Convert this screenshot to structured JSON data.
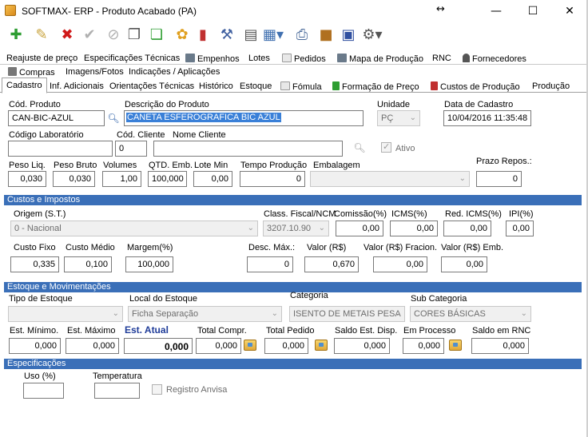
{
  "window": {
    "title": "SOFTMAX- ERP - Produto Acabado (PA)"
  },
  "tabs_row1": [
    "Reajuste de preço",
    "Especificações Técnicas",
    "Empenhos",
    "Lotes",
    "Pedidos",
    "Mapa de Produção",
    "RNC",
    "Fornecedores"
  ],
  "tabs_row2": [
    "Compras",
    "Imagens/Fotos",
    "Indicações / Aplicações"
  ],
  "tabs_row3": [
    "Cadastro",
    "Inf. Adicionais",
    "Orientações Técnicas",
    "Histórico",
    "Estoque",
    "Fómula",
    "Formação de Preço",
    "Custos de Produção",
    "Produção"
  ],
  "cadastro": {
    "cod_produto_label": "Cód. Produto",
    "cod_produto": "CAN-BIC-AZUL",
    "descricao_label": "Descrição do Produto",
    "descricao": "CANETA ESFEROGRAFICA BIC AZUL",
    "unidade_label": "Unidade",
    "unidade": "PÇ",
    "data_cadastro_label": "Data de Cadastro",
    "data_cadastro": "10/04/2016 11:35:48",
    "codigo_lab_label": "Código Laboratório",
    "codigo_lab": "",
    "cod_cliente_label": "Cód. Cliente",
    "cod_cliente": "0",
    "nome_cliente_label": "Nome Cliente",
    "nome_cliente": "",
    "ativo_label": "Ativo",
    "peso_liq_label": "Peso Liq.",
    "peso_liq": "0,030",
    "peso_bruto_label": "Peso Bruto",
    "peso_bruto": "0,030",
    "volumes_label": "Volumes",
    "volumes": "1,00",
    "qtd_emb_label": "QTD. Emb.",
    "qtd_emb": "100,000",
    "lote_min_label": "Lote Min",
    "lote_min": "0,00",
    "tempo_producao_label": "Tempo Produção",
    "tempo_producao": "0",
    "embalagem_label": "Embalagem",
    "embalagem": "",
    "prazo_repos_label": "Prazo Repos.:",
    "prazo_repos": "0"
  },
  "custos": {
    "section_title": "Custos e Impostos",
    "origem_label": "Origem (S.T.)",
    "origem": "0 - Nacional",
    "class_fiscal_label": "Class. Fiscal/NCM",
    "class_fiscal": "3207.10.90",
    "comissao_label": "Comissão(%)",
    "comissao": "0,00",
    "icms_label": "ICMS(%)",
    "icms": "0,00",
    "red_icms_label": "Red. ICMS(%)",
    "red_icms": "0,00",
    "ipi_label": "IPI(%)",
    "ipi": "0,00",
    "custo_fixo_label": "Custo Fixo",
    "custo_fixo": "0,335",
    "custo_medio_label": "Custo Médio",
    "custo_medio": "0,100",
    "margem_label": "Margem(%)",
    "margem": "100,000",
    "desc_max_label": "Desc. Máx.:",
    "desc_max": "0",
    "valor_label": "Valor (R$)",
    "valor": "0,670",
    "valor_fracion_label": "Valor (R$) Fracion.",
    "valor_fracion": "0,00",
    "valor_emb_label": "Valor (R$) Emb.",
    "valor_emb": "0,00"
  },
  "estoque": {
    "section_title": "Estoque e Movimentações",
    "tipo_estoque_label": "Tipo de Estoque",
    "tipo_estoque": "",
    "local_estoque_label": "Local do Estoque",
    "local_estoque": "Ficha Separação",
    "categoria_label": "Categoria",
    "categoria": "ISENTO DE METAIS PESA",
    "sub_categoria_label": "Sub Categoria",
    "sub_categoria": "CORES BÁSICAS",
    "est_minimo_label": "Est. Mínimo.",
    "est_minimo": "0,000",
    "est_maximo_label": "Est. Máximo",
    "est_maximo": "0,000",
    "est_atual_label": "Est. Atual",
    "est_atual": "0,000",
    "total_compr_label": "Total Compr.",
    "total_compr": "0,000",
    "total_pedido_label": "Total Pedido",
    "total_pedido": "0,000",
    "saldo_est_disp_label": "Saldo Est. Disp.",
    "saldo_est_disp": "0,000",
    "em_processo_label": "Em Processo",
    "em_processo": "0,000",
    "saldo_rnc_label": "Saldo em RNC",
    "saldo_rnc": "0,000"
  },
  "especificacoes": {
    "section_title": "Especificações",
    "uso_label": "Uso (%)",
    "uso": "",
    "temperatura_label": "Temperatura",
    "temperatura": "",
    "registro_anvisa_label": "Registro Anvisa"
  }
}
